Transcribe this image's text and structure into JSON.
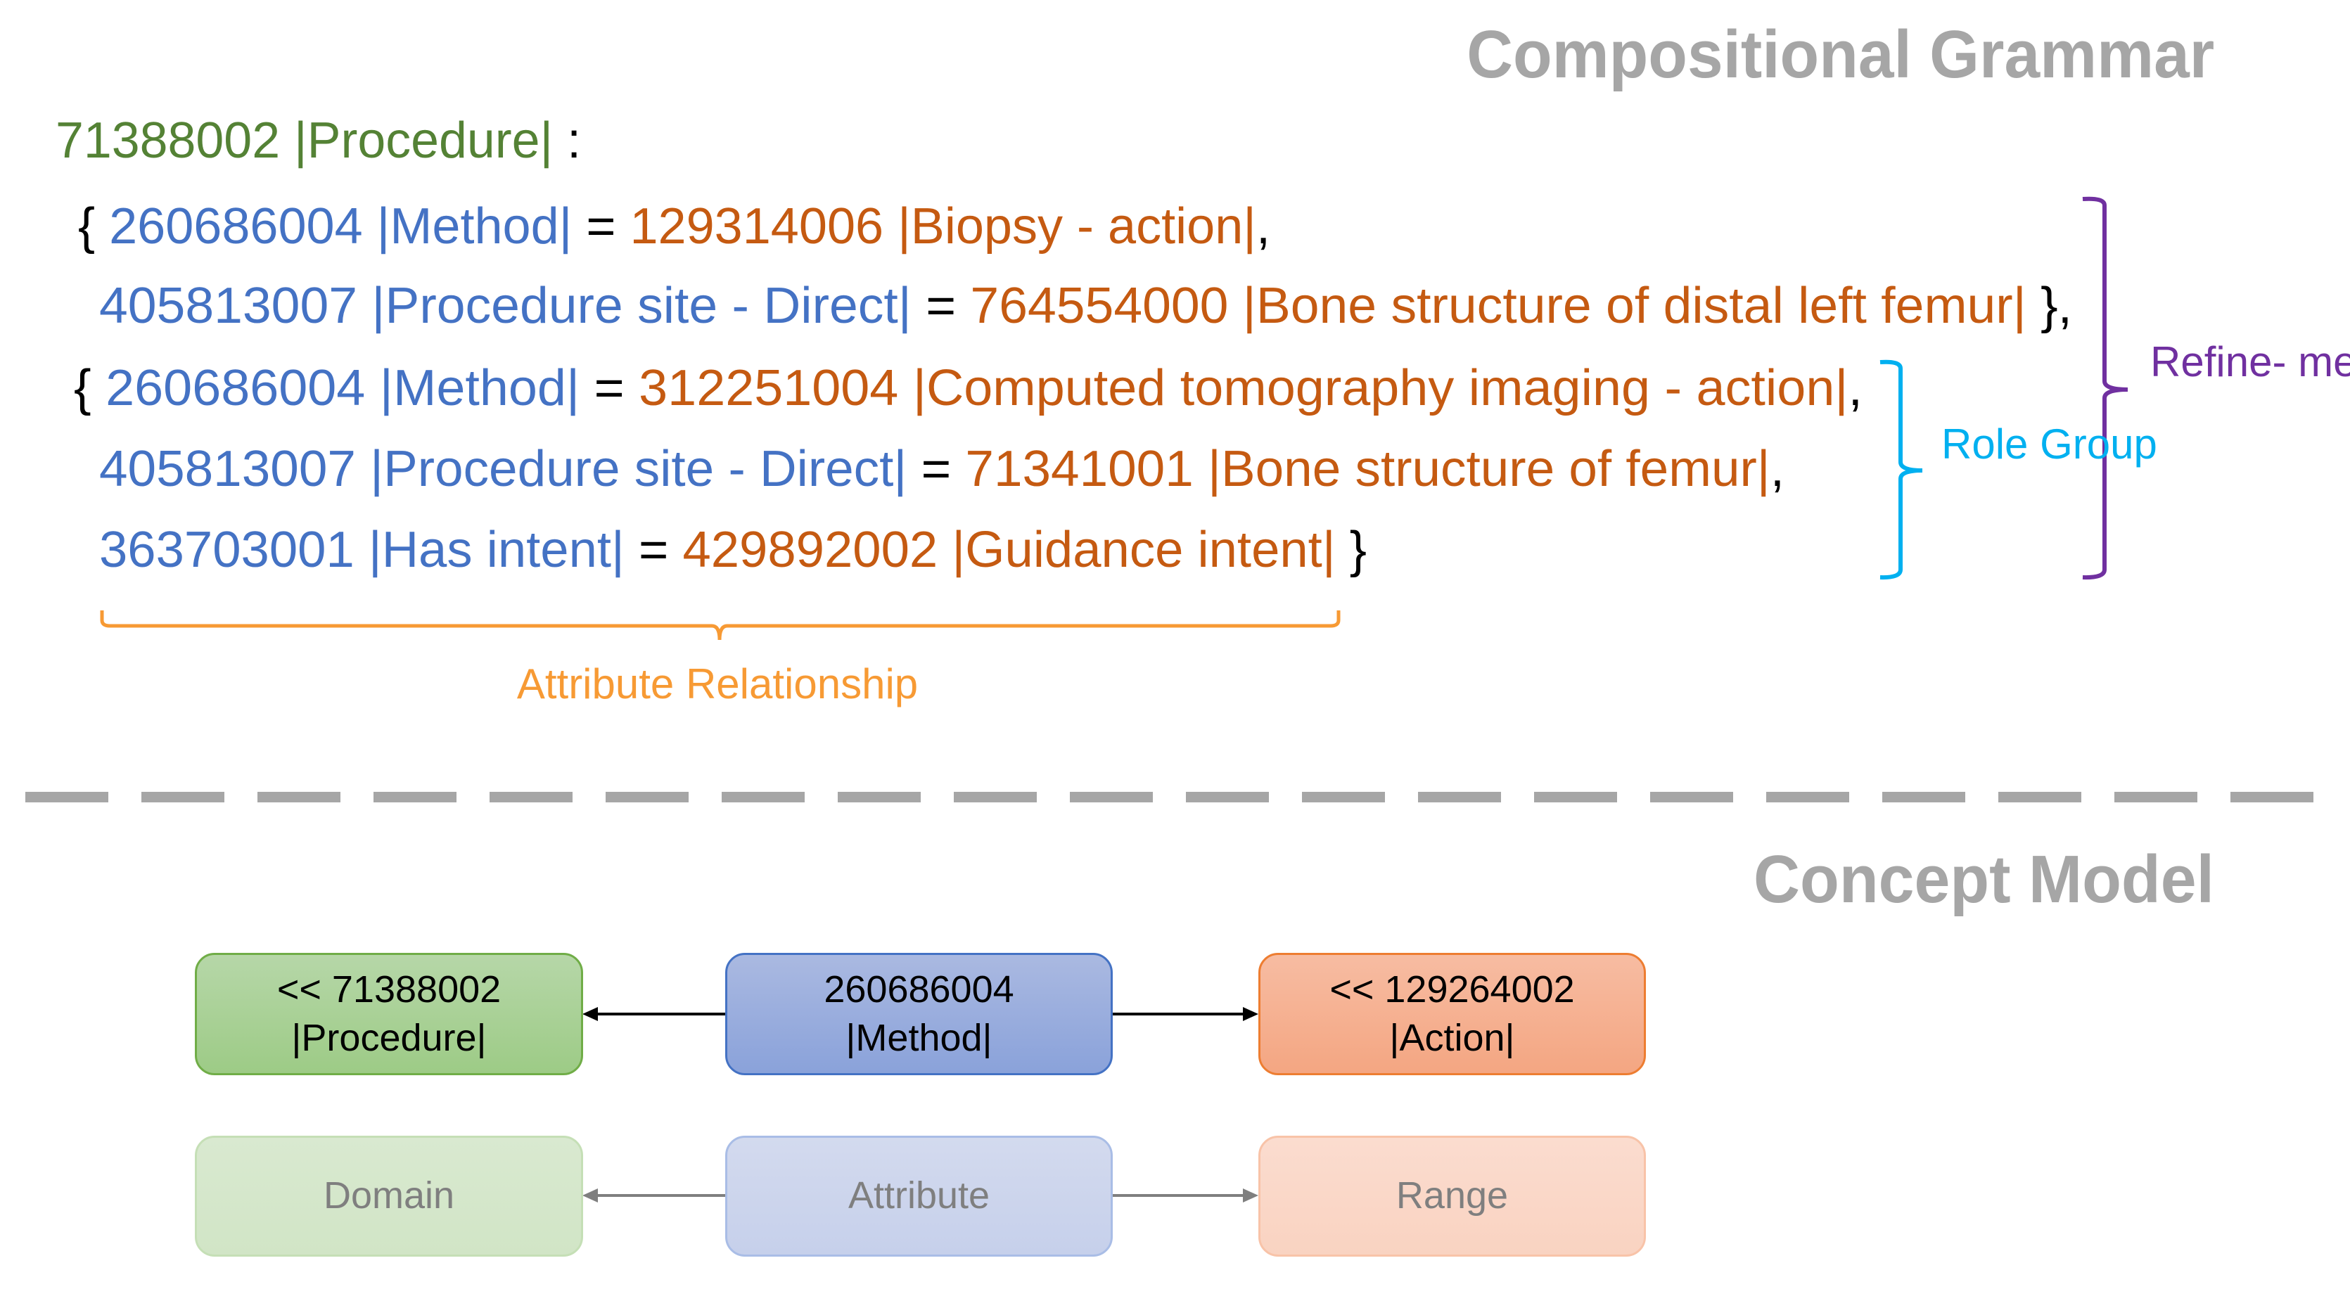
{
  "titles": {
    "grammar": "Compositional Grammar",
    "concept_model": "Concept Model"
  },
  "colors": {
    "focus_concept": "#548235",
    "attribute": "#4472c4",
    "value": "#c55a11",
    "role_group": "#00b0f0",
    "refinement": "#7030a0",
    "attribute_relationship": "#f79a34",
    "section_title": "#a6a6a6"
  },
  "grammar": {
    "lines": [
      {
        "segments": [
          {
            "text": "71388002 |Procedure|",
            "role": "focus"
          },
          {
            "text": " :",
            "role": "punct"
          }
        ]
      },
      {
        "segments": [
          {
            "text": "{ ",
            "role": "punct"
          },
          {
            "text": "260686004 |Method|",
            "role": "attribute"
          },
          {
            "text": " = ",
            "role": "punct"
          },
          {
            "text": "129314006 |Biopsy - action|",
            "role": "value"
          },
          {
            "text": ",",
            "role": "punct"
          }
        ]
      },
      {
        "segments": [
          {
            "text": "405813007 |Procedure site - Direct|",
            "role": "attribute"
          },
          {
            "text": " = ",
            "role": "punct"
          },
          {
            "text": "764554000 |Bone structure of distal left femur|",
            "role": "value"
          },
          {
            "text": " },",
            "role": "punct"
          }
        ]
      },
      {
        "segments": [
          {
            "text": "{ ",
            "role": "punct"
          },
          {
            "text": "260686004 |Method|",
            "role": "attribute"
          },
          {
            "text": " = ",
            "role": "punct"
          },
          {
            "text": "312251004 |Computed tomography imaging - action|",
            "role": "value"
          },
          {
            "text": ",",
            "role": "punct"
          }
        ]
      },
      {
        "segments": [
          {
            "text": "405813007 |Procedure site - Direct|",
            "role": "attribute"
          },
          {
            "text": " = ",
            "role": "punct"
          },
          {
            "text": "71341001 |Bone structure of femur|",
            "role": "value"
          },
          {
            "text": ",",
            "role": "punct"
          }
        ]
      },
      {
        "segments": [
          {
            "text": "363703001 |Has intent|",
            "role": "attribute"
          },
          {
            "text": " = ",
            "role": "punct"
          },
          {
            "text": "429892002 |Guidance intent|",
            "role": "value"
          },
          {
            "text": " }",
            "role": "punct"
          }
        ]
      }
    ],
    "annotations": {
      "refinement_line1": "Refine-",
      "refinement_line2": "ment",
      "role_group_line1": "Role",
      "role_group_line2": "Group",
      "attribute_relationship": "Attribute Relationship"
    }
  },
  "concept_model": {
    "instance": {
      "domain": {
        "line1": "<< 71388002",
        "line2": "|Procedure|"
      },
      "attribute": {
        "line1": "260686004",
        "line2": "|Method|"
      },
      "range": {
        "line1": "<< 129264002",
        "line2": "|Action|"
      }
    },
    "legend": {
      "domain": "Domain",
      "attribute": "Attribute",
      "range": "Range"
    }
  }
}
